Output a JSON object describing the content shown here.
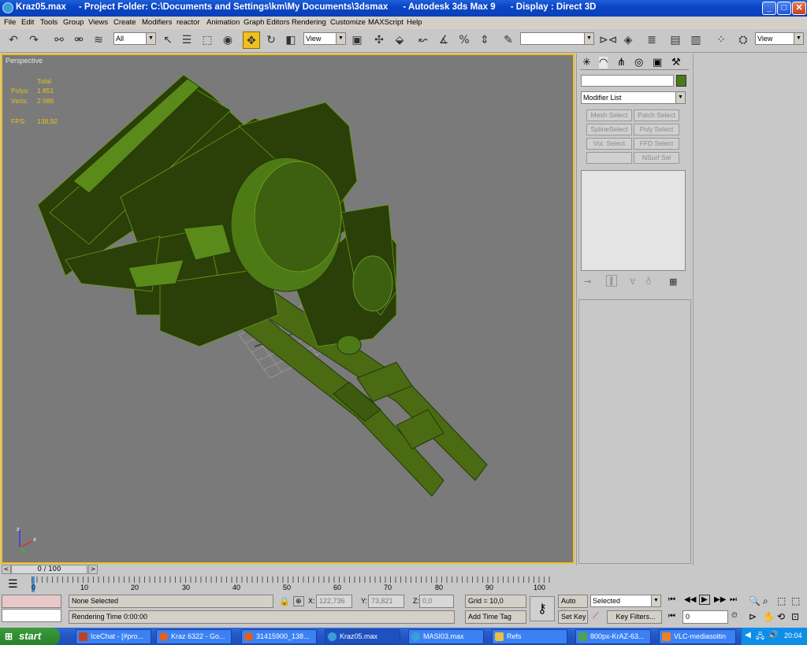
{
  "window": {
    "title": "Kraz05.max     - Project Folder: C:\\Documents and Settings\\km\\My Documents\\3dsmax      - Autodesk 3ds Max 9      - Display : Direct 3D",
    "minimize": "_",
    "maximize": "□",
    "close": "✕"
  },
  "menu": [
    "File",
    "Edit",
    "Tools",
    "Group",
    "Views",
    "Create",
    "Modifiers",
    "reactor",
    "Animation",
    "Graph Editors",
    "Rendering",
    "Customize",
    "MAXScript",
    "Help"
  ],
  "toolbar": {
    "selection_filter": "All",
    "ref_coord": "View",
    "named_selection": "",
    "ref_coord2": "View"
  },
  "viewport": {
    "label": "Perspective",
    "stats": {
      "total_label": "Total",
      "polys_label": "Polys:",
      "polys_value": "1 851",
      "verts_label": "Verts:",
      "verts_value": "2 086",
      "fps_label": "FPS:",
      "fps_value": "138,92"
    },
    "axis": {
      "x": "x",
      "z": "z"
    }
  },
  "command_panel": {
    "name_field": "",
    "object_color": "#4a7a1a",
    "modifier_list": "Modifier List",
    "buttons": [
      [
        "Mesh Select",
        "Patch Select"
      ],
      [
        "SplineSelect",
        "Poly Select"
      ],
      [
        "Vol. Select",
        "FFD Select"
      ],
      [
        "",
        "NSurf Sel"
      ]
    ]
  },
  "timeline": {
    "slider": "0 / 100",
    "ticks": [
      "0",
      "10",
      "20",
      "30",
      "40",
      "50",
      "60",
      "70",
      "80",
      "90",
      "100"
    ]
  },
  "status": {
    "selection": "None Selected",
    "prompt": "Rendering Time  0:00:00",
    "x_label": "X:",
    "x_value": "122,736",
    "y_label": "Y:",
    "y_value": "73,821",
    "z_label": "Z:",
    "z_value": "0,0",
    "grid": "Grid = 10,0",
    "add_time_tag": "Add Time Tag",
    "auto_key": "Auto Key",
    "set_key": "Set Key",
    "key_mode": "Selected",
    "key_filters": "Key Filters...",
    "frame": "0"
  },
  "taskbar": {
    "start": "start",
    "items": [
      {
        "label": "IceChat - [#pro...",
        "color": "#c04020"
      },
      {
        "label": "Kraz 6322 - Go...",
        "color": "#e06020"
      },
      {
        "label": "31415900_138...",
        "color": "#e06020"
      },
      {
        "label": "Kraz05.max",
        "color": "#3a9fd9",
        "active": true
      },
      {
        "label": "MASI03.max",
        "color": "#3a9fd9"
      },
      {
        "label": "Refs",
        "color": "#e8c040"
      },
      {
        "label": "800px-KrAZ-63...",
        "color": "#50a050"
      },
      {
        "label": "VLC-mediasoitin",
        "color": "#f08020"
      }
    ],
    "clock": "20:04"
  }
}
